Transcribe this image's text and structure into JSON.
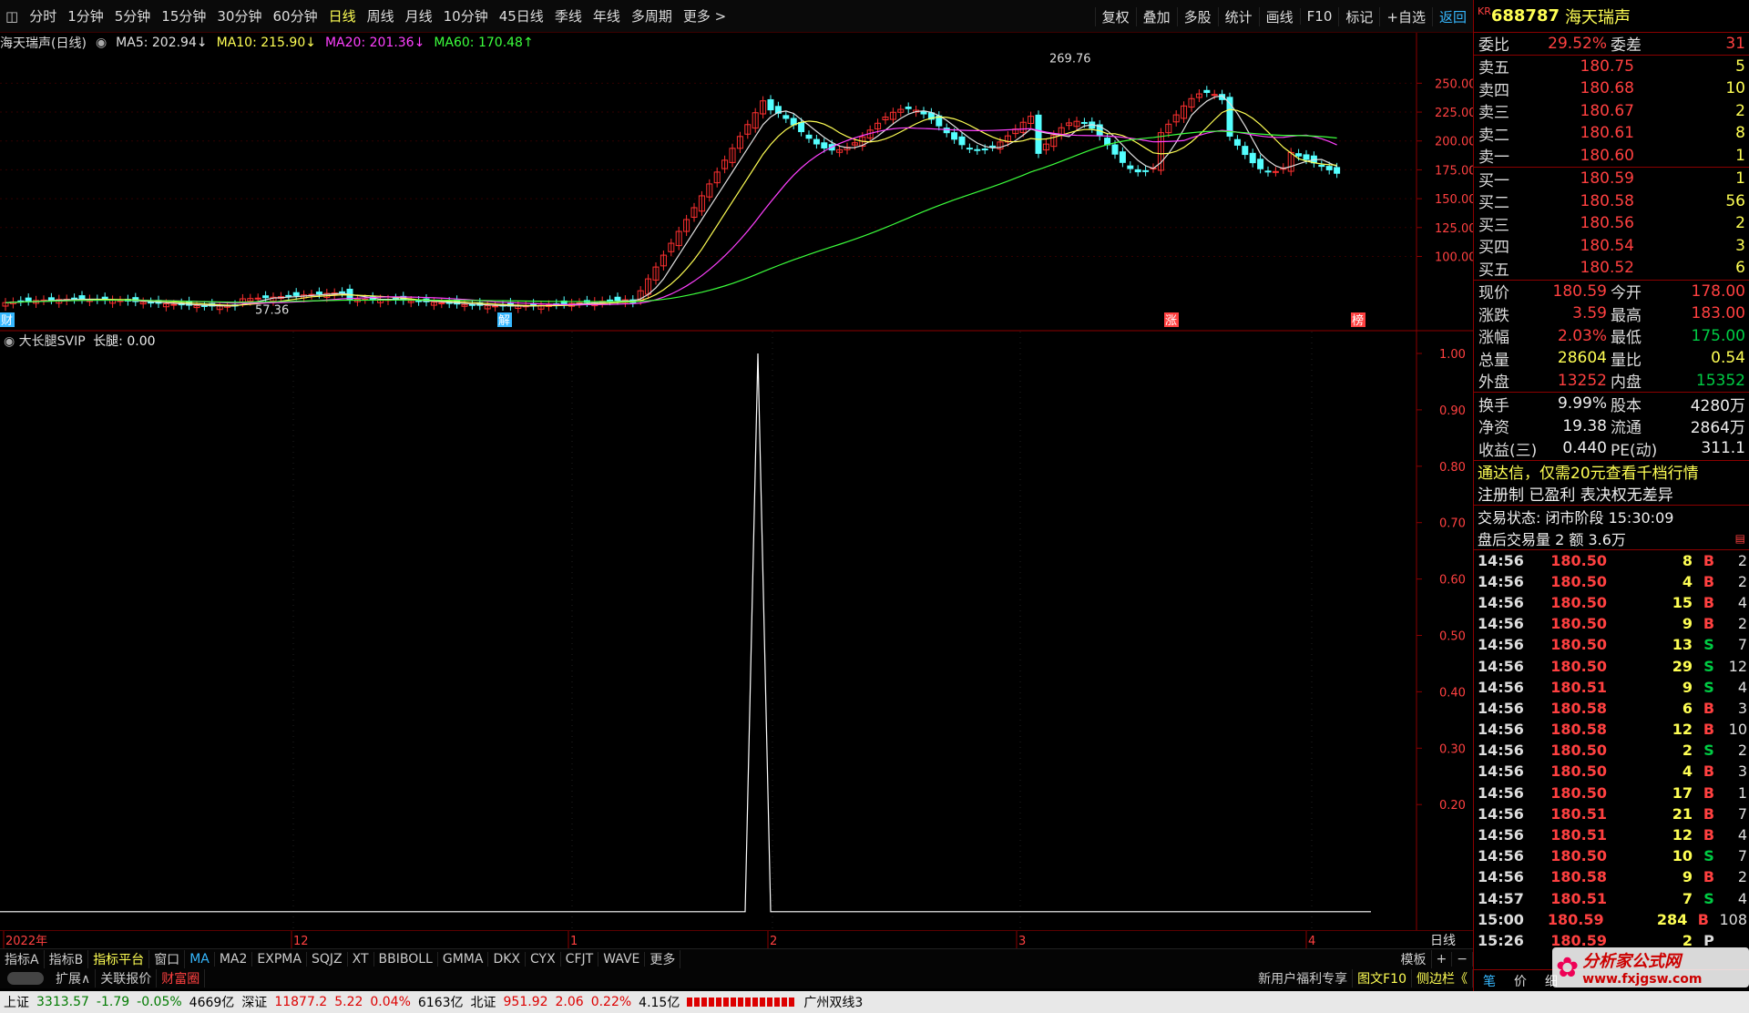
{
  "toolbar": {
    "timeframes": [
      "分时",
      "1分钟",
      "5分钟",
      "15分钟",
      "30分钟",
      "60分钟",
      "日线",
      "周线",
      "月线",
      "10分钟",
      "45日线",
      "季线",
      "年线",
      "多周期",
      "更多 >"
    ],
    "active": "日线",
    "right_tools": [
      "复权",
      "叠加",
      "多股",
      "统计",
      "画线",
      "F10",
      "标记",
      "+自选",
      "返回"
    ]
  },
  "chart_title": "海天瑞声(日线)",
  "ma": [
    {
      "label": "MA5: 202.94↓",
      "color": "#e0e0e0"
    },
    {
      "label": "MA10: 215.90↓",
      "color": "#ffff54"
    },
    {
      "label": "MA20: 201.36↓",
      "color": "#ff40ff"
    },
    {
      "label": "MA60: 170.48↑",
      "color": "#3cff3c"
    }
  ],
  "price_axis": [
    "250.00",
    "225.00",
    "200.00",
    "175.00",
    "150.00",
    "125.00",
    "100.00"
  ],
  "high_label": "269.76",
  "low_label": "57.36",
  "markers": {
    "cai": "财",
    "jie": "解",
    "zhang": "涨",
    "bang": "榜"
  },
  "indicator": {
    "name": "大长腿SVIP",
    "label": "长腿: 0.00",
    "axis": [
      "1.00",
      "0.90",
      "0.80",
      "0.70",
      "0.60",
      "0.50",
      "0.40",
      "0.30",
      "0.20"
    ],
    "spike_value": 1.0
  },
  "date_axis": {
    "labels": [
      "2022年",
      "12",
      "1",
      "2",
      "3",
      "4"
    ],
    "period": "日线"
  },
  "indicator_tabs": [
    "指标A",
    "指标B",
    "指标平台",
    "窗口",
    "MA",
    "MA2",
    "EXPMA",
    "SQJZ",
    "XT",
    "BBIBOLL",
    "GMMA",
    "DKX",
    "CYX",
    "CFJT",
    "WAVE",
    "更多"
  ],
  "template_label": "模板",
  "ext": {
    "expand": "扩展∧",
    "related": "关联报价",
    "wealth": "财富圈",
    "promo": "新用户福利专享",
    "f10": "图文F10",
    "sidebar": "侧边栏《",
    "bar_tabs": [
      "笔",
      "价",
      "细"
    ]
  },
  "stock": {
    "market": "KR",
    "code": "688787",
    "name": "海天瑞声"
  },
  "weibi": {
    "l1": "委比",
    "v1": "29.52%",
    "l2": "委差",
    "v2": "31"
  },
  "asks": [
    {
      "label": "卖五",
      "price": "180.75",
      "vol": "5"
    },
    {
      "label": "卖四",
      "price": "180.68",
      "vol": "10"
    },
    {
      "label": "卖三",
      "price": "180.67",
      "vol": "2"
    },
    {
      "label": "卖二",
      "price": "180.61",
      "vol": "8"
    },
    {
      "label": "卖一",
      "price": "180.60",
      "vol": "1"
    }
  ],
  "bids": [
    {
      "label": "买一",
      "price": "180.59",
      "vol": "1"
    },
    {
      "label": "买二",
      "price": "180.58",
      "vol": "56"
    },
    {
      "label": "买三",
      "price": "180.56",
      "vol": "2"
    },
    {
      "label": "买四",
      "price": "180.54",
      "vol": "3"
    },
    {
      "label": "买五",
      "price": "180.52",
      "vol": "6"
    }
  ],
  "quote": [
    {
      "a": "现价",
      "b": "180.59",
      "bc": "red",
      "c": "今开",
      "d": "178.00",
      "dc": "red"
    },
    {
      "a": "涨跌",
      "b": "3.59",
      "bc": "red",
      "c": "最高",
      "d": "183.00",
      "dc": "red"
    },
    {
      "a": "涨幅",
      "b": "2.03%",
      "bc": "red",
      "c": "最低",
      "d": "175.00",
      "dc": "green"
    },
    {
      "a": "总量",
      "b": "28604",
      "bc": "yellow",
      "c": "量比",
      "d": "0.54",
      "dc": "yellow"
    },
    {
      "a": "外盘",
      "b": "13252",
      "bc": "red",
      "c": "内盘",
      "d": "15352",
      "dc": "green"
    }
  ],
  "fund": [
    {
      "a": "换手",
      "b": "9.99%",
      "c": "股本",
      "d": "4280万"
    },
    {
      "a": "净资",
      "b": "19.38",
      "c": "流通",
      "d": "2864万"
    },
    {
      "a": "收益(三)",
      "b": "0.440",
      "c": "PE(动)",
      "d": "311.1"
    }
  ],
  "ads": [
    "通达信，仅需20元查看千档行情",
    "注册制 已盈利 表决权无差异"
  ],
  "trade_state": "交易状态: 闭市阶段 15:30:09",
  "after_hours": "盘后交易量 2 额 3.6万",
  "ticks": [
    [
      "14:56",
      "180.50",
      "8",
      "B",
      "2"
    ],
    [
      "14:56",
      "180.50",
      "4",
      "B",
      "2"
    ],
    [
      "14:56",
      "180.50",
      "15",
      "B",
      "4"
    ],
    [
      "14:56",
      "180.50",
      "9",
      "B",
      "2"
    ],
    [
      "14:56",
      "180.50",
      "13",
      "S",
      "7"
    ],
    [
      "14:56",
      "180.50",
      "29",
      "S",
      "12"
    ],
    [
      "14:56",
      "180.51",
      "9",
      "S",
      "4"
    ],
    [
      "14:56",
      "180.58",
      "6",
      "B",
      "3"
    ],
    [
      "14:56",
      "180.58",
      "12",
      "B",
      "10"
    ],
    [
      "14:56",
      "180.50",
      "2",
      "S",
      "2"
    ],
    [
      "14:56",
      "180.50",
      "4",
      "B",
      "3"
    ],
    [
      "14:56",
      "180.50",
      "17",
      "B",
      "1"
    ],
    [
      "14:56",
      "180.51",
      "21",
      "B",
      "7"
    ],
    [
      "14:56",
      "180.51",
      "12",
      "B",
      "4"
    ],
    [
      "14:56",
      "180.50",
      "10",
      "S",
      "7"
    ],
    [
      "14:56",
      "180.58",
      "9",
      "B",
      "2"
    ],
    [
      "14:57",
      "180.51",
      "7",
      "S",
      "4"
    ],
    [
      "15:00",
      "180.59",
      "284",
      "B",
      "108"
    ],
    [
      "15:26",
      "180.59",
      "2",
      "P",
      ""
    ]
  ],
  "status": {
    "sh_label": "上证",
    "sh": "3313.57",
    "sh_chg": "-1.79",
    "sh_pct": "-0.05%",
    "sh_amt": "4669亿",
    "sz_label": "深证",
    "sz": "11877.2",
    "sz_chg": "5.22",
    "sz_pct": "0.04%",
    "sz_amt": "6163亿",
    "bz_label": "北证",
    "bz": "951.92",
    "bz_chg": "2.06",
    "bz_pct": "0.22%",
    "bz_amt": "4.15亿",
    "city": "广州双线3"
  },
  "watermark": {
    "title": "分析家公式网",
    "url": "www.fxjgsw.com"
  }
}
